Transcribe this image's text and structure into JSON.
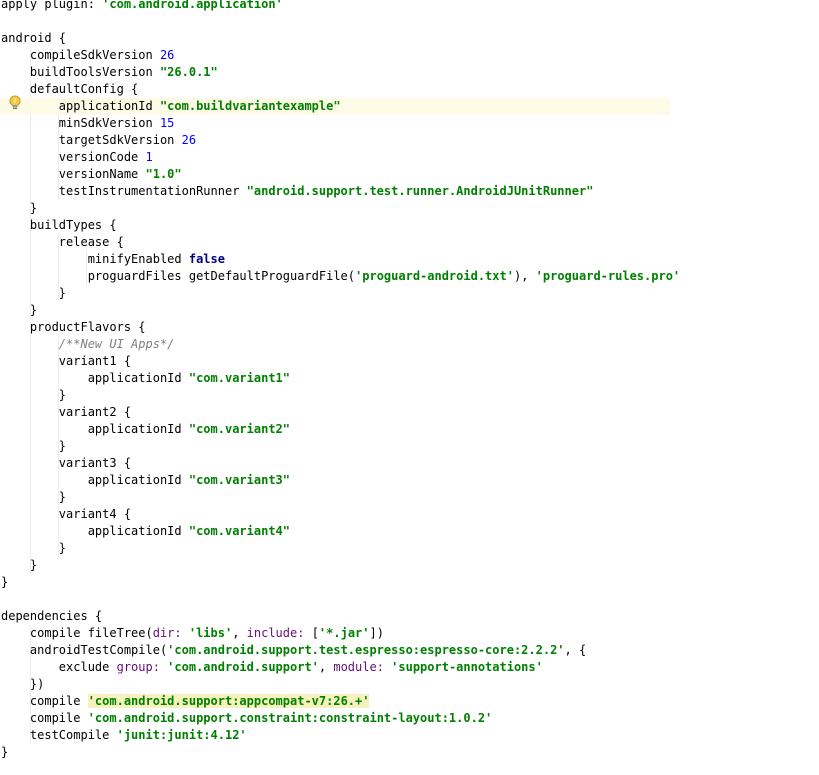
{
  "editor": {
    "language": "gradle",
    "caret_line": 7,
    "colors": {
      "string": "#008000",
      "number": "#0000ff",
      "keyword": "#000080",
      "named_arg": "#660e7a",
      "comment": "#808080",
      "caret_line_bg": "#fdfae6",
      "highlight_bg": "#f6f2bd"
    },
    "gutter_icon": "lightbulb-icon",
    "lines": [
      [
        {
          "t": "apply plugin: ",
          "c": "p"
        },
        {
          "t": "'com.android.application'",
          "c": "str"
        }
      ],
      [],
      [
        {
          "t": "android {",
          "c": "p"
        }
      ],
      [
        {
          "t": "    compileSdkVersion ",
          "c": "p"
        },
        {
          "t": "26",
          "c": "num"
        }
      ],
      [
        {
          "t": "    buildToolsVersion ",
          "c": "p"
        },
        {
          "t": "\"26.0.1\"",
          "c": "str"
        }
      ],
      [
        {
          "t": "    defaultConfig {",
          "c": "p"
        }
      ],
      [
        {
          "t": "        applicationId ",
          "c": "p"
        },
        {
          "t": "\"com.buildvariantexample\"",
          "c": "str"
        }
      ],
      [
        {
          "t": "        minSdkVersion ",
          "c": "p"
        },
        {
          "t": "15",
          "c": "num"
        }
      ],
      [
        {
          "t": "        targetSdkVersion ",
          "c": "p"
        },
        {
          "t": "26",
          "c": "num"
        }
      ],
      [
        {
          "t": "        versionCode ",
          "c": "p"
        },
        {
          "t": "1",
          "c": "num"
        }
      ],
      [
        {
          "t": "        versionName ",
          "c": "p"
        },
        {
          "t": "\"1.0\"",
          "c": "str"
        }
      ],
      [
        {
          "t": "        testInstrumentationRunner ",
          "c": "p"
        },
        {
          "t": "\"android.support.test.runner.AndroidJUnitRunner\"",
          "c": "str"
        }
      ],
      [
        {
          "t": "    }",
          "c": "p"
        }
      ],
      [
        {
          "t": "    buildTypes {",
          "c": "p"
        }
      ],
      [
        {
          "t": "        release {",
          "c": "p"
        }
      ],
      [
        {
          "t": "            minifyEnabled ",
          "c": "p"
        },
        {
          "t": "false",
          "c": "kw"
        }
      ],
      [
        {
          "t": "            proguardFiles getDefaultProguardFile(",
          "c": "p"
        },
        {
          "t": "'proguard-android.txt'",
          "c": "str"
        },
        {
          "t": "), ",
          "c": "p"
        },
        {
          "t": "'proguard-rules.pro'",
          "c": "str"
        }
      ],
      [
        {
          "t": "        }",
          "c": "p"
        }
      ],
      [
        {
          "t": "    }",
          "c": "p"
        }
      ],
      [
        {
          "t": "    productFlavors {",
          "c": "p"
        }
      ],
      [
        {
          "t": "        ",
          "c": "p"
        },
        {
          "t": "/**New UI Apps*/",
          "c": "cmt"
        }
      ],
      [
        {
          "t": "        variant1 {",
          "c": "p"
        }
      ],
      [
        {
          "t": "            applicationId ",
          "c": "p"
        },
        {
          "t": "\"com.variant1\"",
          "c": "str"
        }
      ],
      [
        {
          "t": "        }",
          "c": "p"
        }
      ],
      [
        {
          "t": "        variant2 {",
          "c": "p"
        }
      ],
      [
        {
          "t": "            applicationId ",
          "c": "p"
        },
        {
          "t": "\"com.variant2\"",
          "c": "str"
        }
      ],
      [
        {
          "t": "        }",
          "c": "p"
        }
      ],
      [
        {
          "t": "        variant3 {",
          "c": "p"
        }
      ],
      [
        {
          "t": "            applicationId ",
          "c": "p"
        },
        {
          "t": "\"com.variant3\"",
          "c": "str"
        }
      ],
      [
        {
          "t": "        }",
          "c": "p"
        }
      ],
      [
        {
          "t": "        variant4 {",
          "c": "p"
        }
      ],
      [
        {
          "t": "            applicationId ",
          "c": "p"
        },
        {
          "t": "\"com.variant4\"",
          "c": "str"
        }
      ],
      [
        {
          "t": "        }",
          "c": "p"
        }
      ],
      [
        {
          "t": "    }",
          "c": "p"
        }
      ],
      [
        {
          "t": "}",
          "c": "p"
        }
      ],
      [],
      [
        {
          "t": "dependencies {",
          "c": "p"
        }
      ],
      [
        {
          "t": "    compile fileTree(",
          "c": "p"
        },
        {
          "t": "dir: ",
          "c": "key"
        },
        {
          "t": "'libs'",
          "c": "str"
        },
        {
          "t": ", ",
          "c": "p"
        },
        {
          "t": "include: ",
          "c": "key"
        },
        {
          "t": "[",
          "c": "p"
        },
        {
          "t": "'*.jar'",
          "c": "str"
        },
        {
          "t": "])",
          "c": "p"
        }
      ],
      [
        {
          "t": "    androidTestCompile(",
          "c": "p"
        },
        {
          "t": "'com.android.support.test.espresso:espresso-core:2.2.2'",
          "c": "str"
        },
        {
          "t": ", {",
          "c": "p"
        }
      ],
      [
        {
          "t": "        exclude ",
          "c": "p"
        },
        {
          "t": "group: ",
          "c": "key"
        },
        {
          "t": "'com.android.support'",
          "c": "str"
        },
        {
          "t": ", ",
          "c": "p"
        },
        {
          "t": "module: ",
          "c": "key"
        },
        {
          "t": "'support-annotations'",
          "c": "str"
        }
      ],
      [
        {
          "t": "    })",
          "c": "p"
        }
      ],
      [
        {
          "t": "    compile ",
          "c": "p"
        },
        {
          "t": "'com.android.support:appcompat-v7:26.+'",
          "c": "strhl"
        }
      ],
      [
        {
          "t": "    compile ",
          "c": "p"
        },
        {
          "t": "'com.android.support.constraint:constraint-layout:1.0.2'",
          "c": "str"
        }
      ],
      [
        {
          "t": "    testCompile ",
          "c": "p"
        },
        {
          "t": "'junit:junit:4.12'",
          "c": "str"
        }
      ],
      [
        {
          "t": "}",
          "c": "p"
        }
      ]
    ]
  }
}
